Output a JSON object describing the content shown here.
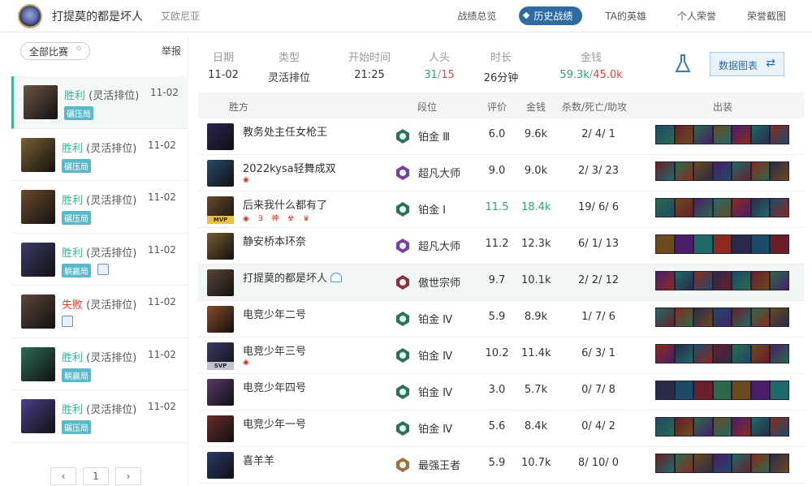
{
  "header": {
    "player_name": "打提莫的都是坏人",
    "server": "艾欧尼亚",
    "nav": [
      "战绩总览",
      "历史战绩",
      "TA的英雄",
      "个人荣誉",
      "荣誉截图"
    ],
    "active_nav": "历史战绩"
  },
  "sidebar": {
    "filter_label": "全部比赛",
    "report_label": "举报",
    "matches": [
      {
        "result": "胜利",
        "mode": "(灵活排位)",
        "date": "11-02",
        "tag": "碾压局",
        "win": true,
        "color": "#6b5443"
      },
      {
        "result": "胜利",
        "mode": "(灵活排位)",
        "date": "11-02",
        "tag": "碾压局",
        "win": true,
        "color": "#7a6036"
      },
      {
        "result": "胜利",
        "mode": "(灵活排位)",
        "date": "11-02",
        "tag": "碾压局",
        "win": true,
        "color": "#6d4a2c"
      },
      {
        "result": "胜利",
        "mode": "(灵活排位)",
        "date": "11-02",
        "tag": "躺赢局",
        "win": true,
        "color": "#3a3a6a"
      },
      {
        "result": "失败",
        "mode": "(灵活排位)",
        "date": "11-02",
        "tag": "",
        "win": false,
        "color": "#5c4638"
      },
      {
        "result": "胜利",
        "mode": "(灵活排位)",
        "date": "11-02",
        "tag": "躺赢局",
        "win": true,
        "color": "#2f6a55"
      },
      {
        "result": "胜利",
        "mode": "(灵活排位)",
        "date": "11-02",
        "tag": "碾压局",
        "win": true,
        "color": "#4a3f8a"
      }
    ],
    "page": "1"
  },
  "summary": {
    "date_h": "日期",
    "date": "11-02",
    "type_h": "类型",
    "type": "灵活排位",
    "start_h": "开始时间",
    "start": "21:25",
    "kills_h": "人头",
    "kills_win": "31",
    "kills_sep": "/",
    "kills_lose": "15",
    "dur_h": "时长",
    "dur": "26分钟",
    "gold_h": "金钱",
    "gold_win": "59.3k",
    "gold_sep": "/",
    "gold_lose": "45.0k",
    "chart_button": "数据图表"
  },
  "table": {
    "headers": {
      "team": "胜方",
      "rank": "段位",
      "score": "评价",
      "gold": "金钱",
      "kda": "杀数/死亡/助攻",
      "items": "出装"
    },
    "rows": [
      {
        "name": "教务处主任女枪王",
        "rank": "铂金 Ⅲ",
        "score": "6.0",
        "gold": "9.6k",
        "kda": "2/ 4/ 1",
        "champ": "#2b2350",
        "rankc": "#2e6f5e",
        "badges": "",
        "label": "",
        "me": false,
        "hl": false
      },
      {
        "name": "2022kysa轻舞成双",
        "rank": "超凡大师",
        "score": "9.0",
        "gold": "9.0k",
        "kda": "2/ 3/ 23",
        "champ": "#2a4a6a",
        "rankc": "#7a3fa0",
        "badges": "◉",
        "label": "",
        "me": false,
        "hl": false
      },
      {
        "name": "后来我什么都有了",
        "rank": "铂金 Ⅰ",
        "score": "11.5",
        "gold": "18.4k",
        "kda": "19/ 6/ 6",
        "champ": "#6a4a2a",
        "rankc": "#2e6f5e",
        "badges": "◉ ∃ 神 ☢ ♛",
        "label": "MVP",
        "me": false,
        "hl": true
      },
      {
        "name": "静安桥本环奈",
        "rank": "超凡大师",
        "score": "11.2",
        "gold": "12.3k",
        "kda": "6/ 1/ 13",
        "champ": "#7a5a30",
        "rankc": "#7a3fa0",
        "badges": "",
        "label": "",
        "me": false,
        "hl": false
      },
      {
        "name": "打提莫的都是坏人",
        "rank": "傲世宗师",
        "score": "9.7",
        "gold": "10.1k",
        "kda": "2/ 2/ 12",
        "champ": "#5c4638",
        "rankc": "#8a3040",
        "badges": "",
        "label": "",
        "me": true,
        "hl": false
      },
      {
        "name": "电竞少年二号",
        "rank": "铂金 Ⅳ",
        "score": "5.9",
        "gold": "8.9k",
        "kda": "1/ 7/ 6",
        "champ": "#8a4a2a",
        "rankc": "#2e6f5e",
        "badges": "",
        "label": "",
        "me": false,
        "hl": false
      },
      {
        "name": "电竞少年三号",
        "rank": "铂金 Ⅳ",
        "score": "10.2",
        "gold": "11.4k",
        "kda": "6/ 3/ 1",
        "champ": "#3a3a6a",
        "rankc": "#2e6f5e",
        "badges": "◉",
        "label": "SVP",
        "me": false,
        "hl": false
      },
      {
        "name": "电竞少年四号",
        "rank": "铂金 Ⅳ",
        "score": "3.0",
        "gold": "5.7k",
        "kda": "0/ 7/ 8",
        "champ": "#5a3a6a",
        "rankc": "#2e6f5e",
        "badges": "",
        "label": "",
        "me": false,
        "hl": false
      },
      {
        "name": "电竞少年一号",
        "rank": "铂金 Ⅳ",
        "score": "5.6",
        "gold": "8.4k",
        "kda": "0/ 4/ 2",
        "champ": "#6a2a2a",
        "rankc": "#2e6f5e",
        "badges": "",
        "label": "",
        "me": false,
        "hl": false
      },
      {
        "name": "喜羊羊",
        "rank": "最强王者",
        "score": "5.9",
        "gold": "10.7k",
        "kda": "8/ 10/ 0",
        "champ": "#2a3a6a",
        "rankc": "#a07040",
        "badges": "",
        "label": "",
        "me": false,
        "hl": false
      }
    ]
  },
  "colors": {
    "win": "#3bb592",
    "lose": "#e0443a",
    "accent": "#2d6ca3",
    "item_palette": [
      "#1e4a6a",
      "#6a1e2a",
      "#2a6a4a",
      "#6a4a1e",
      "#4a1e6a",
      "#1e6a6a",
      "#8a2a1e",
      "#2a2a4a"
    ]
  }
}
